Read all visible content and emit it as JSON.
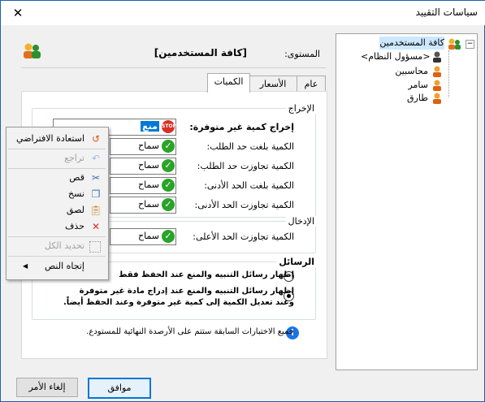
{
  "window": {
    "title": "سياسات التقييد",
    "close": "✕"
  },
  "tree": {
    "root": "كافة المستخدمين",
    "items": [
      "<مسؤول النظام>",
      "محاسبين",
      "سامر",
      "طارق"
    ]
  },
  "level": {
    "label": "المستوى:",
    "value": "[كافة المستخدمين]"
  },
  "tabs": [
    "عام",
    "الأسعار",
    "الكميات"
  ],
  "output": {
    "title": "الإخراج",
    "rows": [
      {
        "label": "إخراج كمية غير متوفرة:",
        "value": "منع",
        "icon": "stop-icon"
      },
      {
        "label": "الكمية بلغت حد الطلب:",
        "value": "سماح",
        "icon": "check-icon"
      },
      {
        "label": "الكمية تجاوزت حد الطلب:",
        "value": "سماح",
        "icon": "check-icon"
      },
      {
        "label": "الكمية بلغت الحد الأدنى:",
        "value": "سماح",
        "icon": "check-icon"
      },
      {
        "label": "الكمية تجاوزت الحد الأدنى:",
        "value": "سماح",
        "icon": "check-icon"
      }
    ]
  },
  "input": {
    "title": "الإدخال",
    "rows": [
      {
        "label": "الكمية تجاوزت الحد الأعلى:",
        "value": "سماح",
        "icon": "check-icon"
      }
    ]
  },
  "messages": {
    "title": "الرسائل",
    "option1": "إظهار رسائل التنبيه والمنع عند الحفظ فقط",
    "option2_line1": "إظهار رسائل التنبيه والمنع عند إدراج مادة غير متوفرة",
    "option2_line2": "وعند تعديل الكمية إلى كمية غير متوفرة وعند الحفظ أيضاً.",
    "selected": 2
  },
  "info": "جميع الاختبارات السابقة ستتم على الأرصدة النهائية للمستودع.",
  "buttons": {
    "ok": "موافق",
    "cancel": "إلغاء الأمر"
  },
  "context_menu": {
    "items": [
      {
        "label": "استعادة الافتراضي",
        "icon": "restore-icon",
        "enabled": true
      },
      {
        "label": "تراجع",
        "icon": "undo-icon",
        "enabled": false
      },
      {
        "label": "قص",
        "icon": "cut-icon",
        "enabled": true
      },
      {
        "label": "نسخ",
        "icon": "copy-icon",
        "enabled": true
      },
      {
        "label": "لصق",
        "icon": "paste-icon",
        "enabled": true
      },
      {
        "label": "حذف",
        "icon": "delete-icon",
        "enabled": true
      },
      {
        "label": "تحديد الكل",
        "icon": "select-all-icon",
        "enabled": false
      },
      {
        "label": "إتجاه النص",
        "icon": "submenu-arrow-icon",
        "enabled": true
      }
    ]
  },
  "colors": {
    "accent": "#0078d7",
    "check": "#29a329",
    "stop": "#d93025",
    "info": "#1a73e8"
  }
}
